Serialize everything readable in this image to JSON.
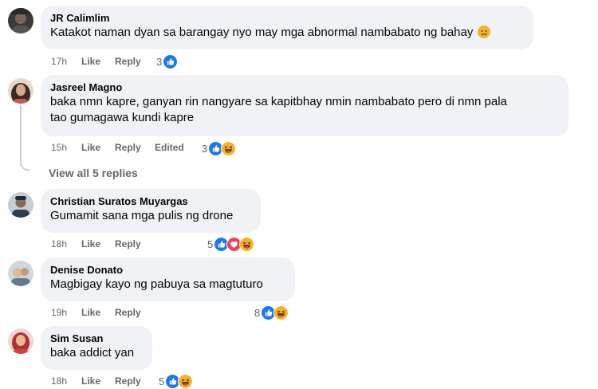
{
  "comments": [
    {
      "author": "JR Calimlim",
      "text": "Katakot naman dyan sa barangay nyo may mga abnormal nambabato ng bahay",
      "time": "17h",
      "like": "Like",
      "reply": "Reply",
      "reaction_count": "3",
      "reactions": [
        "like"
      ]
    },
    {
      "author": "Jasreel Magno",
      "text_line1": "baka nmn kapre, ganyan rin nangyare sa kapitbhay nmin nambabato pero di nmn pala",
      "text_line2": "tao gumagawa kundi kapre",
      "time": "15h",
      "like": "Like",
      "reply": "Reply",
      "edited": "Edited",
      "reaction_count": "3",
      "reactions": [
        "like",
        "haha"
      ]
    },
    {
      "author": "Christian Suratos Muyargas",
      "text": "Gumamit sana mga pulis ng drone",
      "time": "18h",
      "like": "Like",
      "reply": "Reply",
      "reaction_count": "5",
      "reactions": [
        "like",
        "love",
        "haha"
      ]
    },
    {
      "author": "Denise Donato",
      "text": "Magbigay kayo ng pabuya sa magtuturo",
      "time": "19h",
      "like": "Like",
      "reply": "Reply",
      "reaction_count": "8",
      "reactions": [
        "like",
        "haha"
      ]
    },
    {
      "author": "Sim Susan",
      "text": "baka addict yan",
      "time": "18h",
      "like": "Like",
      "reply": "Reply",
      "reaction_count": "5",
      "reactions": [
        "like",
        "haha"
      ]
    }
  ],
  "view_replies": "View all 5 replies",
  "colors": {
    "bubble": "#f0f2f5",
    "meta": "#65676b",
    "like_blue": "#1877f2",
    "love_red": "#f33e58",
    "haha_yellow": "#f7b125"
  },
  "icons": {
    "like": "thumbs-up-icon",
    "love": "heart-icon",
    "haha": "laughing-face-icon",
    "sad": "sad-face-icon"
  }
}
